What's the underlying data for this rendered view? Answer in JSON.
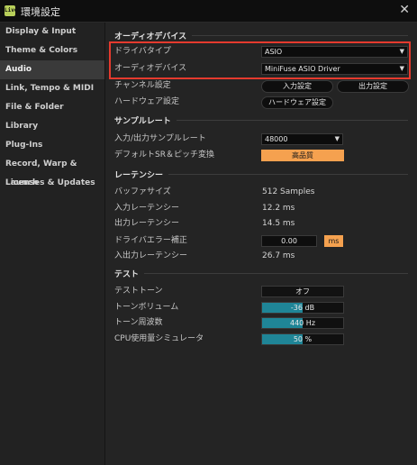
{
  "window": {
    "title": "環境設定",
    "app_badge": "Live"
  },
  "sidebar": {
    "items": [
      {
        "label": "Display & Input"
      },
      {
        "label": "Theme & Colors"
      },
      {
        "label": "Audio",
        "active": true
      },
      {
        "label": "Link, Tempo & MIDI"
      },
      {
        "label": "File & Folder"
      },
      {
        "label": "Library"
      },
      {
        "label": "Plug-Ins"
      },
      {
        "label": "Record, Warp & Launch"
      },
      {
        "label": "Licenses & Updates"
      }
    ]
  },
  "audio_device": {
    "header": "オーディオデバイス",
    "driver_type_label": "ドライバタイプ",
    "driver_type_value": "ASIO",
    "device_label": "オーディオデバイス",
    "device_value": "MiniFuse ASIO Driver",
    "channel_label": "チャンネル設定",
    "input_settings": "入力設定",
    "output_settings": "出力設定",
    "hardware_label": "ハードウェア設定",
    "hardware_button": "ハードウェア設定"
  },
  "sample_rate": {
    "header": "サンプルレート",
    "io_rate_label": "入力/出力サンプルレート",
    "io_rate_value": "48000",
    "default_sr_label": "デフォルトSR＆ピッチ変換",
    "default_sr_value": "高品質"
  },
  "latency": {
    "header": "レーテンシー",
    "buffer_label": "バッファサイズ",
    "buffer_value": "512 Samples",
    "input_label": "入力レーテンシー",
    "input_value": "12.2 ms",
    "output_label": "出力レーテンシー",
    "output_value": "14.5 ms",
    "driver_error_label": "ドライバエラー補正",
    "driver_error_value": "0.00",
    "driver_error_unit": "ms",
    "overall_label": "入出力レーテンシー",
    "overall_value": "26.7 ms"
  },
  "test": {
    "header": "テスト",
    "tone_label": "テストトーン",
    "tone_value": "オフ",
    "volume_label": "トーンボリューム",
    "volume_value": "-36 dB",
    "volume_level": 0.5,
    "freq_label": "トーン周波数",
    "freq_value": "440 Hz",
    "freq_level": 0.5,
    "cpu_label": "CPU使用量シミュレータ",
    "cpu_value": "50 %",
    "cpu_level": 0.5
  },
  "colors": {
    "accent": "#f5a14f",
    "slider": "#1f8597",
    "highlight": "#e53a2e"
  }
}
